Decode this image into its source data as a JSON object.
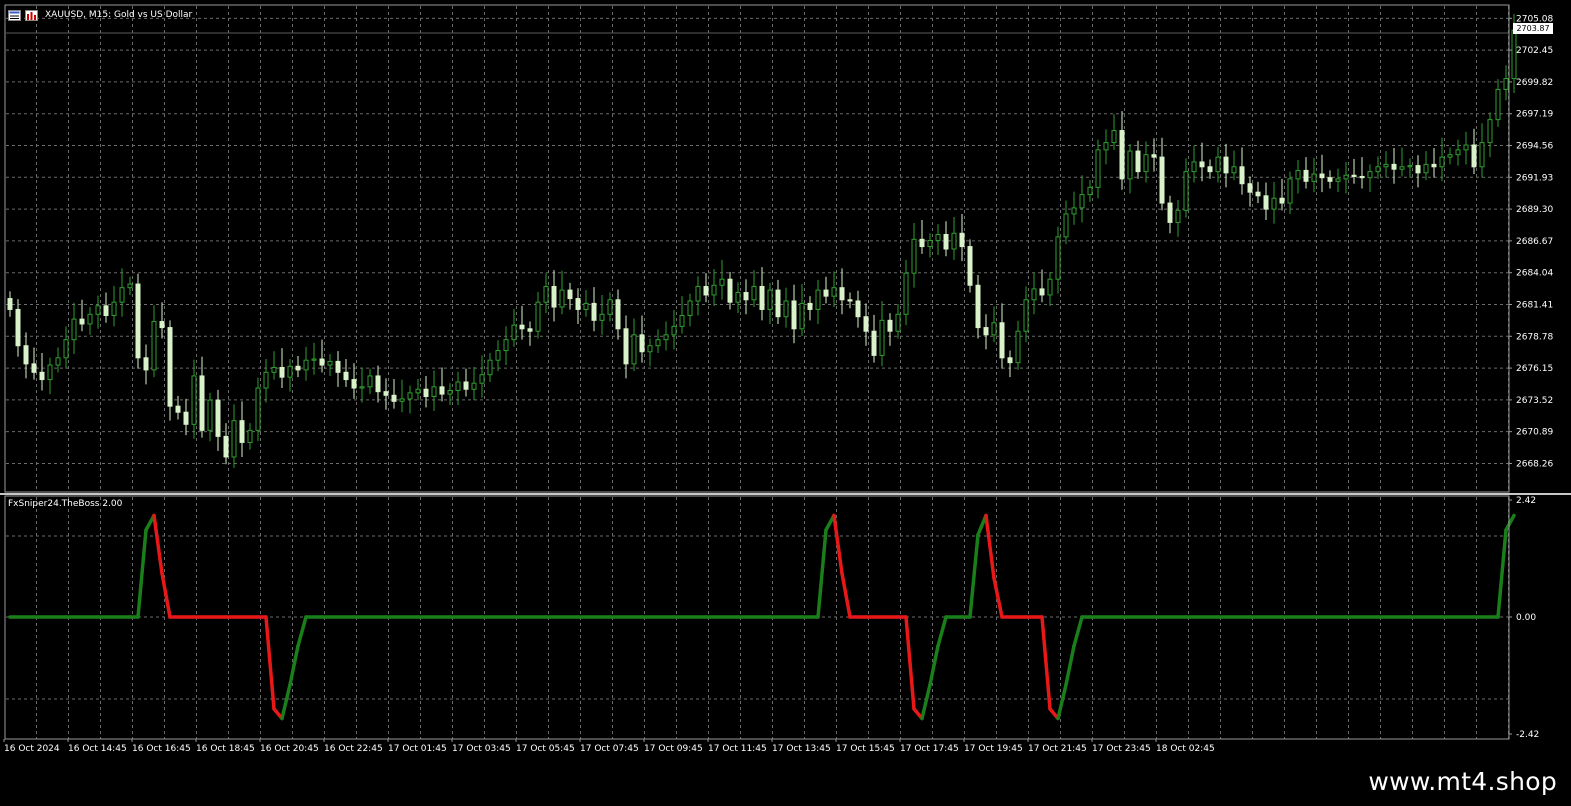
{
  "window": {
    "symbol_title": "XAUUSD, M15:  Gold vs US Dollar",
    "indicator_title": "FxSniper24.TheBoss 2.00",
    "current_price": "2703.87"
  },
  "watermark": "www.mt4.shop",
  "colors": {
    "background": "#000000",
    "grid": "#6b6b6b",
    "candle_up": "#2f9e2f",
    "candle_down": "#d9f2c9",
    "indicator_rising": "#1a7f1a",
    "indicator_falling": "#e81818"
  },
  "icons": [
    "chart-window-icon",
    "bar-chart-icon"
  ],
  "chart_data": [
    {
      "type": "candlestick",
      "y_axis_ticks": [
        "2705.08",
        "2702.45",
        "2699.82",
        "2697.19",
        "2694.56",
        "2691.93",
        "2689.30",
        "2686.67",
        "2684.04",
        "2681.41",
        "2678.78",
        "2676.15",
        "2673.52",
        "2670.89",
        "2668.26"
      ],
      "ylim": [
        2665.9,
        2706.1
      ],
      "x_axis_ticks": [
        "16 Oct 2024",
        "16 Oct 14:45",
        "16 Oct 16:45",
        "16 Oct 18:45",
        "16 Oct 20:45",
        "16 Oct 22:45",
        "17 Oct 01:45",
        "17 Oct 03:45",
        "17 Oct 05:45",
        "17 Oct 07:45",
        "17 Oct 09:45",
        "17 Oct 11:45",
        "17 Oct 13:45",
        "17 Oct 15:45",
        "17 Oct 17:45",
        "17 Oct 19:45",
        "17 Oct 21:45",
        "17 Oct 23:45",
        "18 Oct 02:45"
      ],
      "candles_per_tick": 8,
      "close": [
        2681.0,
        2678.0,
        2676.5,
        2675.8,
        2675.2,
        2676.4,
        2677.0,
        2678.5,
        2680.2,
        2679.8,
        2680.6,
        2681.3,
        2680.5,
        2681.6,
        2682.8,
        2683.1,
        2677.0,
        2676.0,
        2680.0,
        2679.5,
        2673.0,
        2672.5,
        2671.5,
        2675.5,
        2671.0,
        2673.5,
        2670.5,
        2668.8,
        2671.8,
        2670.0,
        2671.0,
        2674.5,
        2675.8,
        2676.2,
        2675.4,
        2676.3,
        2676.0,
        2676.8,
        2676.9,
        2676.4,
        2676.7,
        2675.8,
        2675.2,
        2674.5,
        2674.6,
        2675.5,
        2674.2,
        2673.9,
        2673.4,
        2673.6,
        2674.1,
        2674.4,
        2673.8,
        2674.6,
        2674.0,
        2674.3,
        2675.0,
        2674.4,
        2674.9,
        2675.6,
        2676.8,
        2677.6,
        2678.5,
        2679.7,
        2679.4,
        2679.2,
        2681.6,
        2682.9,
        2681.2,
        2682.6,
        2681.9,
        2681.0,
        2681.5,
        2680.1,
        2680.6,
        2681.8,
        2679.4,
        2676.5,
        2678.9,
        2677.5,
        2678.0,
        2678.5,
        2678.9,
        2679.6,
        2680.5,
        2681.7,
        2682.9,
        2682.2,
        2683.0,
        2683.5,
        2681.6,
        2682.4,
        2681.8,
        2682.9,
        2681.0,
        2682.6,
        2680.4,
        2681.7,
        2679.4,
        2681.5,
        2681.0,
        2682.6,
        2682.1,
        2682.8,
        2681.8,
        2681.7,
        2680.4,
        2679.2,
        2677.2,
        2680.1,
        2679.2,
        2680.6,
        2684.0,
        2686.8,
        2686.2,
        2686.7,
        2687.2,
        2686.0,
        2687.3,
        2686.2,
        2683.0,
        2679.5,
        2678.9,
        2679.9,
        2677.0,
        2676.6,
        2679.2,
        2681.8,
        2682.7,
        2682.2,
        2683.5,
        2687.0,
        2688.9,
        2689.4,
        2690.5,
        2691.1,
        2694.2,
        2694.8,
        2695.8,
        2691.8,
        2694.1,
        2692.4,
        2693.8,
        2693.6,
        2689.8,
        2688.2,
        2689.2,
        2692.4,
        2693.2,
        2692.8,
        2692.4,
        2693.6,
        2692.3,
        2692.8,
        2691.4,
        2690.7,
        2690.4,
        2689.3,
        2690.2,
        2689.8,
        2691.8,
        2692.5,
        2691.6,
        2692.2,
        2691.9,
        2691.6,
        2691.8,
        2692.1,
        2692.0,
        2691.9,
        2692.4,
        2692.8,
        2693.0,
        2692.6,
        2692.8,
        2692.9,
        2692.3,
        2693.0,
        2692.8,
        2693.6,
        2693.8,
        2694.2,
        2694.6,
        2692.8,
        2694.8,
        2696.7,
        2699.2,
        2700.1,
        2704.1
      ],
      "open": [
        2681.9,
        2681.0,
        2678.0,
        2676.5,
        2675.8,
        2675.2,
        2676.4,
        2677.0,
        2678.5,
        2680.2,
        2679.8,
        2680.6,
        2681.3,
        2680.5,
        2681.6,
        2682.8,
        2683.1,
        2677.0,
        2676.0,
        2680.0,
        2679.5,
        2673.0,
        2672.5,
        2671.5,
        2675.5,
        2671.0,
        2673.5,
        2670.5,
        2668.8,
        2671.8,
        2670.0,
        2671.0,
        2674.5,
        2675.8,
        2676.2,
        2675.4,
        2676.3,
        2676.0,
        2676.8,
        2676.9,
        2676.4,
        2676.7,
        2675.8,
        2675.2,
        2674.5,
        2674.6,
        2675.5,
        2674.2,
        2673.9,
        2673.4,
        2673.6,
        2674.1,
        2674.4,
        2673.8,
        2674.6,
        2674.0,
        2674.3,
        2675.0,
        2674.4,
        2674.9,
        2675.6,
        2676.8,
        2677.6,
        2678.5,
        2679.7,
        2679.4,
        2679.2,
        2681.6,
        2682.9,
        2681.2,
        2682.6,
        2681.9,
        2681.0,
        2681.5,
        2680.1,
        2680.6,
        2681.8,
        2679.4,
        2676.5,
        2678.9,
        2677.5,
        2678.0,
        2678.5,
        2678.9,
        2679.6,
        2680.5,
        2681.7,
        2682.9,
        2682.2,
        2683.0,
        2683.5,
        2681.6,
        2682.4,
        2681.8,
        2682.9,
        2681.0,
        2682.6,
        2680.4,
        2681.7,
        2679.4,
        2681.5,
        2681.0,
        2682.6,
        2682.1,
        2682.8,
        2681.8,
        2681.7,
        2680.4,
        2679.2,
        2677.2,
        2680.1,
        2679.2,
        2680.6,
        2684.0,
        2686.8,
        2686.2,
        2686.7,
        2687.2,
        2686.0,
        2687.3,
        2686.2,
        2683.0,
        2679.5,
        2678.9,
        2679.9,
        2677.0,
        2676.6,
        2679.2,
        2681.8,
        2682.7,
        2682.2,
        2683.5,
        2687.0,
        2688.9,
        2689.4,
        2690.5,
        2691.1,
        2694.2,
        2694.8,
        2695.8,
        2691.8,
        2694.1,
        2692.4,
        2693.8,
        2693.6,
        2689.8,
        2688.2,
        2689.2,
        2692.4,
        2693.2,
        2692.8,
        2692.4,
        2693.6,
        2692.3,
        2692.8,
        2691.4,
        2690.7,
        2690.4,
        2689.3,
        2690.2,
        2689.8,
        2691.8,
        2692.5,
        2691.6,
        2692.2,
        2691.9,
        2691.6,
        2691.8,
        2692.1,
        2692.0,
        2691.9,
        2692.4,
        2692.8,
        2693.0,
        2692.6,
        2692.8,
        2692.9,
        2692.3,
        2693.0,
        2692.8,
        2693.6,
        2693.8,
        2694.2,
        2694.6,
        2692.8,
        2694.8,
        2696.7,
        2699.2,
        2700.1
      ]
    },
    {
      "type": "line",
      "y_axis_ticks": [
        "2.42",
        "0.00",
        "-2.42"
      ],
      "ylim": [
        -2.42,
        2.42
      ],
      "values": [
        0,
        0,
        0,
        0,
        0,
        0,
        0,
        0,
        0,
        0,
        0,
        0,
        0,
        0,
        0,
        0,
        0,
        1.8,
        2.1,
        0.9,
        0,
        0,
        0,
        0,
        0,
        0,
        0,
        0,
        0,
        0,
        0,
        0,
        0,
        -1.9,
        -2.1,
        -1.4,
        -0.6,
        0,
        0,
        0,
        0,
        0,
        0,
        0,
        0,
        0,
        0,
        0,
        0,
        0,
        0,
        0,
        0,
        0,
        0,
        0,
        0,
        0,
        0,
        0,
        0,
        0,
        0,
        0,
        0,
        0,
        0,
        0,
        0,
        0,
        0,
        0,
        0,
        0,
        0,
        0,
        0,
        0,
        0,
        0,
        0,
        0,
        0,
        0,
        0,
        0,
        0,
        0,
        0,
        0,
        0,
        0,
        0,
        0,
        0,
        0,
        0,
        0,
        0,
        0,
        0,
        0,
        1.8,
        2.1,
        0.9,
        0,
        0,
        0,
        0,
        0,
        0,
        0,
        0,
        -1.9,
        -2.1,
        -1.4,
        -0.6,
        0,
        0,
        0,
        0,
        1.7,
        2.1,
        0.8,
        0,
        0,
        0,
        0,
        0,
        0,
        -1.9,
        -2.1,
        -1.4,
        -0.6,
        0,
        0,
        0,
        0,
        0,
        0,
        0,
        0,
        0,
        0,
        0,
        0,
        0,
        0,
        0,
        0,
        0,
        0,
        0,
        0,
        0,
        0,
        0,
        0,
        0,
        0,
        0,
        0,
        0,
        0,
        0,
        0,
        0,
        0,
        0,
        0,
        0,
        0,
        0,
        0,
        0,
        0,
        0,
        0,
        0,
        0,
        0,
        0,
        0,
        0,
        0,
        0,
        0,
        1.8,
        2.1
      ]
    }
  ]
}
